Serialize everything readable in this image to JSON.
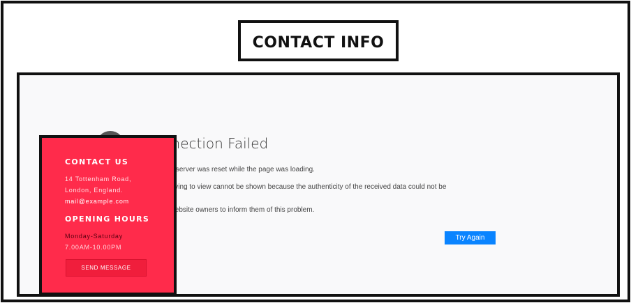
{
  "header": {
    "title": "CONTACT INFO"
  },
  "error_page": {
    "title": "e Connection Failed",
    "line1": "ion to the server was reset while the page was loading.",
    "line2": "you are trying to view cannot be shown because the authenticity of the received data could not be",
    "line3": "tact the website owners to inform them of this problem.",
    "try_again_label": "Try Again"
  },
  "contact_card": {
    "contact_heading": "CONTACT US",
    "address_line1": "14 Tottenham Road,",
    "address_line2": "London, England.",
    "email": "mail@example.com",
    "hours_heading": "OPENING HOURS",
    "days": "Monday-Saturday",
    "hours": "7.00AM-10.00PM",
    "send_label": "SEND MESSAGE"
  },
  "colors": {
    "card_bg": "#ff2b4b",
    "button_blue": "#0a84ff",
    "border": "#111111"
  }
}
